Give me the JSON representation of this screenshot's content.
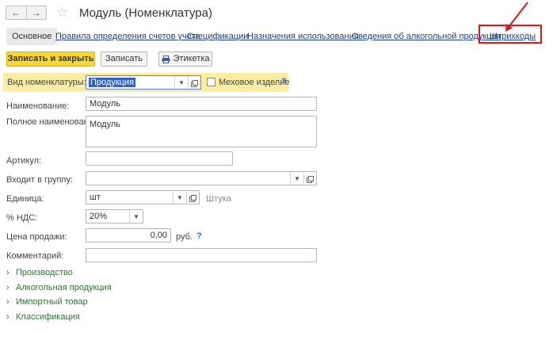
{
  "window": {
    "title": "Модуль (Номенклатура)",
    "nav_back": "←",
    "nav_forward": "→",
    "star": "☆"
  },
  "tabs": [
    {
      "label": "Основное"
    },
    {
      "label": "Правила определения счетов учета"
    },
    {
      "label": "Спецификации"
    },
    {
      "label": "Назначения использования"
    },
    {
      "label": "Сведения об алкогольной продукции"
    },
    {
      "label": "Штрихкоды"
    }
  ],
  "toolbar": {
    "save_close": "Записать и закрыть",
    "save": "Записать",
    "label_btn": "Этикетка"
  },
  "form": {
    "kind_label": "Вид номенклатуры:",
    "kind_value": "Продукция",
    "fur_label": "Меховое изделие",
    "help": "?",
    "name_label": "Наименование:",
    "name_value": "Модуль",
    "fullname_label": "Полное наименование:",
    "fullname_value": "Модуль",
    "article_label": "Артикул:",
    "article_value": "",
    "group_label": "Входит в группу:",
    "group_value": "",
    "unit_label": "Единица:",
    "unit_value": "шт",
    "unit_hint": "Штука",
    "vat_label": "% НДС:",
    "vat_value": "20%",
    "price_label": "Цена продажи:",
    "price_value": "0,00",
    "price_currency": "руб.",
    "comment_label": "Комментарий:",
    "comment_value": ""
  },
  "sections": [
    {
      "label": "Производство"
    },
    {
      "label": "Алкогольная продукция"
    },
    {
      "label": "Импортный товар"
    },
    {
      "label": "Классификация"
    }
  ],
  "colors": {
    "highlight": "#e1161b",
    "primary_button": "#f7d833",
    "link": "#1a3e8c",
    "section": "#2a7a2e"
  }
}
